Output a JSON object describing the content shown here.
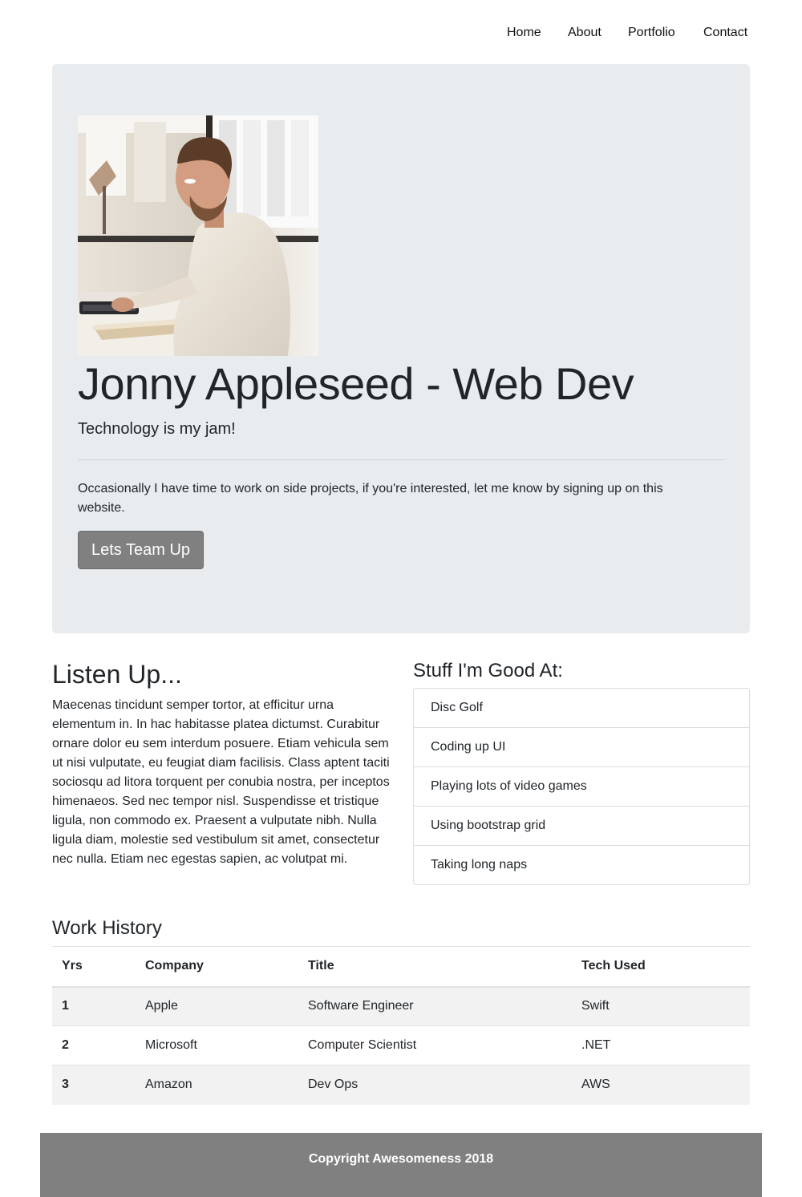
{
  "nav": {
    "links": [
      "Home",
      "About",
      "Portfolio",
      "Contact"
    ]
  },
  "hero": {
    "photo_alt": "man-working-at-computer",
    "title": "Jonny Appleseed - Web Dev",
    "lead": "Technology is my jam!",
    "intro": "Occasionally I have time to work on side projects, if you're interested, let me know by signing up on this website.",
    "cta_label": "Lets Team Up"
  },
  "listen": {
    "title": "Listen Up...",
    "body": "Maecenas tincidunt semper tortor, at efficitur urna elementum in. In hac habitasse platea dictumst. Curabitur ornare dolor eu sem interdum posuere. Etiam vehicula sem ut nisi vulputate, eu feugiat diam facilisis. Class aptent taciti sociosqu ad litora torquent per conubia nostra, per inceptos himenaeos. Sed nec tempor nisl. Suspendisse et tristique ligula, non commodo ex. Praesent a vulputate nibh. Nulla ligula diam, molestie sed vestibulum sit amet, consectetur nec nulla. Etiam nec egestas sapien, ac volutpat mi."
  },
  "skills": {
    "title": "Stuff I'm Good At:",
    "items": [
      "Disc Golf",
      "Coding up UI",
      "Playing lots of video games",
      "Using bootstrap grid",
      "Taking long naps"
    ]
  },
  "work": {
    "title": "Work History",
    "headers": [
      "Yrs",
      "Company",
      "Title",
      "Tech Used"
    ],
    "rows": [
      [
        "1",
        "Apple",
        "Software Engineer",
        "Swift"
      ],
      [
        "2",
        "Microsoft",
        "Computer Scientist",
        ".NET"
      ],
      [
        "3",
        "Amazon",
        "Dev Ops",
        "AWS"
      ]
    ]
  },
  "footer": {
    "text": "Copyright Awesomeness 2018"
  },
  "colors": {
    "jumbotron_bg": "#e9ecef",
    "button_bg": "#808080",
    "footer_bg": "#808080",
    "stripe_bg": "#f2f2f2"
  }
}
